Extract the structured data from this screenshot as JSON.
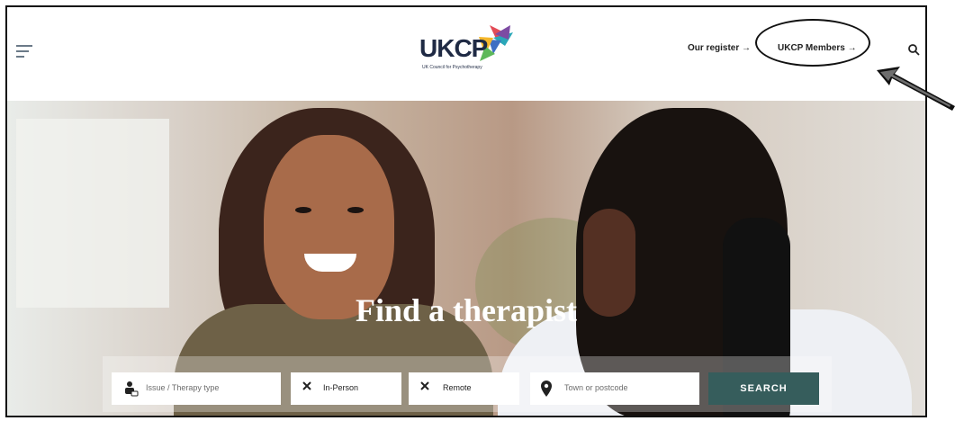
{
  "header": {
    "logo_text": "UKCP",
    "logo_subtitle": "UK Council for Psychotherapy",
    "nav": {
      "register_label": "Our register",
      "members_label": "UKCP Members",
      "arrow_symbol": "→"
    },
    "icons": {
      "menu": "menu-icon",
      "search": "search-icon"
    }
  },
  "hero": {
    "headline": "Find a therapist"
  },
  "search_form": {
    "issue_placeholder": "Issue / Therapy type",
    "in_person_label": "In-Person",
    "remote_label": "Remote",
    "location_placeholder": "Town or postcode",
    "button_label": "SEARCH"
  },
  "colors": {
    "brand_dark": "#1f2a44",
    "search_button": "#365d5c",
    "accent_outline": "#111111"
  }
}
